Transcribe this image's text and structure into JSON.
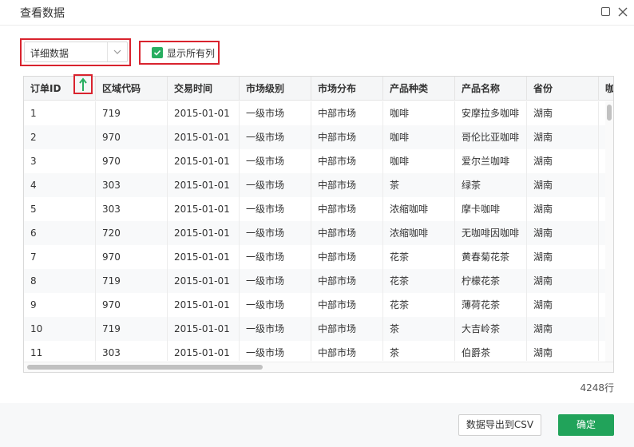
{
  "dialog": {
    "title": "查看数据"
  },
  "toolbar": {
    "select_value": "详细数据",
    "show_all_columns_label": "显示所有列",
    "show_all_columns_checked": true
  },
  "table": {
    "columns": [
      "订单ID",
      "区域代码",
      "交易时间",
      "市场级别",
      "市场分布",
      "产品种类",
      "产品名称",
      "省份",
      "咖"
    ],
    "rows": [
      [
        "1",
        "719",
        "2015-01-01",
        "一级市场",
        "中部市场",
        "咖啡",
        "安摩拉多咖啡",
        "湖南"
      ],
      [
        "2",
        "970",
        "2015-01-01",
        "一级市场",
        "中部市场",
        "咖啡",
        "哥伦比亚咖啡",
        "湖南"
      ],
      [
        "3",
        "970",
        "2015-01-01",
        "一级市场",
        "中部市场",
        "咖啡",
        "爱尔兰咖啡",
        "湖南"
      ],
      [
        "4",
        "303",
        "2015-01-01",
        "一级市场",
        "中部市场",
        "茶",
        "绿茶",
        "湖南"
      ],
      [
        "5",
        "303",
        "2015-01-01",
        "一级市场",
        "中部市场",
        "浓缩咖啡",
        "摩卡咖啡",
        "湖南"
      ],
      [
        "6",
        "720",
        "2015-01-01",
        "一级市场",
        "中部市场",
        "浓缩咖啡",
        "无咖啡因咖啡",
        "湖南"
      ],
      [
        "7",
        "970",
        "2015-01-01",
        "一级市场",
        "中部市场",
        "花茶",
        "黄春菊花茶",
        "湖南"
      ],
      [
        "8",
        "719",
        "2015-01-01",
        "一级市场",
        "中部市场",
        "花茶",
        "柠檬花茶",
        "湖南"
      ],
      [
        "9",
        "970",
        "2015-01-01",
        "一级市场",
        "中部市场",
        "花茶",
        "薄荷花茶",
        "湖南"
      ],
      [
        "10",
        "719",
        "2015-01-01",
        "一级市场",
        "中部市场",
        "茶",
        "大吉岭茶",
        "湖南"
      ],
      [
        "11",
        "303",
        "2015-01-01",
        "一级市场",
        "中部市场",
        "茶",
        "伯爵茶",
        "湖南"
      ]
    ],
    "row_count": "4248行"
  },
  "footer": {
    "export_label": "数据导出到CSV",
    "ok_label": "确定"
  },
  "colors": {
    "accent": "#21a35a",
    "highlight": "#d9232e",
    "sort_arrow": "#27ae60"
  },
  "icons": {
    "maximize": "maximize-icon",
    "close": "close-icon",
    "sort": "sort-ascending-arrow-icon",
    "dropdown": "chevron-down-icon",
    "check": "check-icon"
  }
}
